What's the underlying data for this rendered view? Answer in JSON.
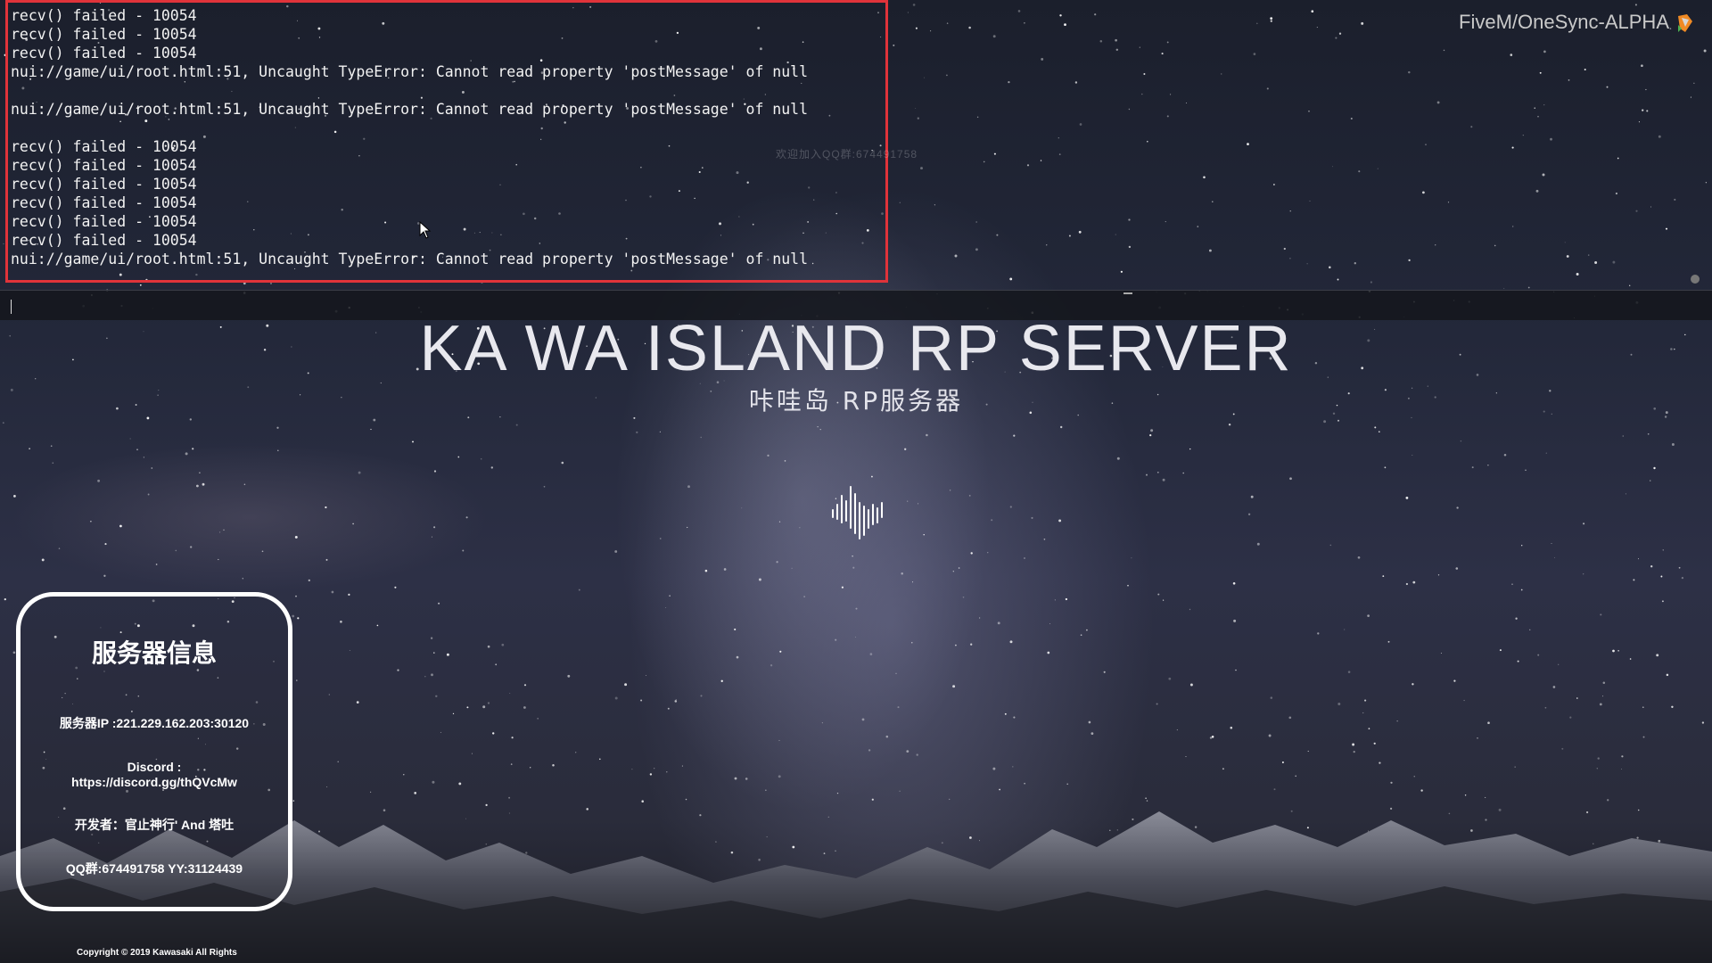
{
  "console": {
    "lines": [
      "recv() failed - 10054",
      "recv() failed - 10054",
      "recv() failed - 10054",
      "nui://game/ui/root.html:51, Uncaught TypeError: Cannot read property 'postMessage' of null",
      "",
      "nui://game/ui/root.html:51, Uncaught TypeError: Cannot read property 'postMessage' of null",
      "",
      "recv() failed - 10054",
      "recv() failed - 10054",
      "recv() failed - 10054",
      "recv() failed - 10054",
      "recv() failed - 10054",
      "recv() failed - 10054",
      "nui://game/ui/root.html:51, Uncaught TypeError: Cannot read property 'postMessage' of null"
    ],
    "watermark": "欢迎加入QQ群:674491758",
    "highlight_color": "#e0333a"
  },
  "build": {
    "label": "FiveM/OneSync-ALPHA",
    "icon": "fivem-logo-icon"
  },
  "loading_screen": {
    "title": "KA WA ISLAND RP SERVER",
    "subtitle": "咔哇岛 RP服务器",
    "loader_icon": "audio-wave-icon"
  },
  "info_panel": {
    "title": "服务器信息",
    "server_ip": "服务器IP :221.229.162.203:30120",
    "discord_label": "Discord :",
    "discord_url": "https://discord.gg/thQVcMw",
    "developers": "开发者：官止神行' And 塔吐",
    "contact": "QQ群:674491758 YY:31124439"
  },
  "copyright": "Copyright © 2019 Kawasaki All Rights"
}
